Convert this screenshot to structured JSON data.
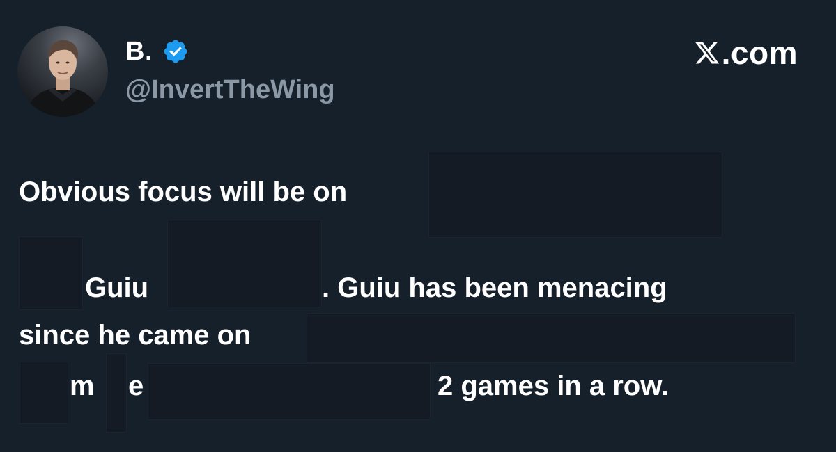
{
  "author": {
    "display_name": "B.",
    "handle": "@InvertTheWing",
    "verified": true,
    "avatar_icon": "profile-photo",
    "verified_icon": "verified-badge-icon"
  },
  "branding": {
    "logo_icon": "x-logo-icon",
    "domain_suffix": ".com"
  },
  "tweet": {
    "line1": "Obvious focus will be on",
    "line2_word": "Guiu",
    "line2_rest": ". Guiu has been menacing",
    "line3": "since he came on",
    "line4_fragment_a": "m",
    "line4_fragment_b": "e",
    "line4_rest": "2 games in a row."
  },
  "colors": {
    "background": "#15202b",
    "text_primary": "#ffffff",
    "text_secondary": "#8b98a5",
    "verified_blue": "#1d9bf0",
    "redaction": "#141b24"
  }
}
